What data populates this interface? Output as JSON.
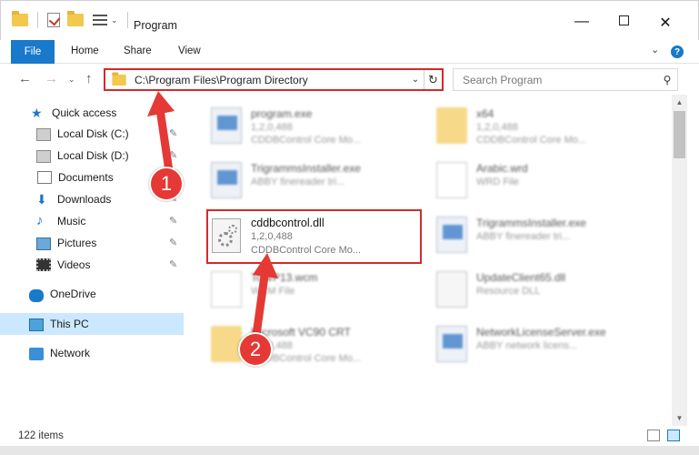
{
  "window": {
    "title": "Program",
    "min_glyph": "—",
    "close_glyph": "✕"
  },
  "ribbon": {
    "file": "File",
    "home": "Home",
    "share": "Share",
    "view": "View",
    "expand_glyph": "⌄",
    "help_glyph": "?"
  },
  "nav": {
    "back_glyph": "←",
    "forward_glyph": "→",
    "history_glyph": "⌄",
    "up_glyph": "↑",
    "address": "C:\\Program Files\\Program Directory",
    "address_dropdown_glyph": "⌄",
    "refresh_glyph": "↻",
    "search_placeholder": "Search Program",
    "search_glyph": "⚲"
  },
  "sidebar": {
    "items": [
      {
        "label": "Quick access",
        "icon": "star-icon"
      },
      {
        "label": "Local Disk (C:)",
        "icon": "disk-icon",
        "pinned": true
      },
      {
        "label": "Local Disk (D:)",
        "icon": "disk-icon",
        "pinned": true
      },
      {
        "label": "Documents",
        "icon": "documents-icon",
        "pinned": true
      },
      {
        "label": "Downloads",
        "icon": "downloads-icon",
        "pinned": true
      },
      {
        "label": "Music",
        "icon": "music-icon",
        "pinned": true
      },
      {
        "label": "Pictures",
        "icon": "pictures-icon",
        "pinned": true
      },
      {
        "label": "Videos",
        "icon": "videos-icon",
        "pinned": true
      },
      {
        "label": "OneDrive",
        "icon": "onedrive-icon"
      },
      {
        "label": "This PC",
        "icon": "this-pc-icon",
        "selected": true
      },
      {
        "label": "Network",
        "icon": "network-icon"
      }
    ],
    "pin_glyph": "📌"
  },
  "files": [
    {
      "name": "program.exe",
      "meta1": "1,2,0,488",
      "meta2": "CDDBControl Core Mo...",
      "type": "exe"
    },
    {
      "name": "x64",
      "meta1": "1,2,0,488",
      "meta2": "CDDBControl Core Mo...",
      "type": "folder"
    },
    {
      "name": "TrigrammsInstaller.exe",
      "meta1": "ABBY finereader tri...",
      "meta2": "",
      "type": "exe"
    },
    {
      "name": "Arabic.wrd",
      "meta1": "WRD File",
      "meta2": "",
      "type": "doc"
    },
    {
      "name": "cddbcontrol.dll",
      "meta1": "1,2,0,488",
      "meta2": "CDDBControl Core Mo...",
      "type": "dll",
      "highlighted": true
    },
    {
      "name": "TrigrammsInstaller.exe",
      "meta1": "ABBY finereader tri...",
      "meta2": "",
      "type": "exe"
    },
    {
      "name": "ToWP13.wcm",
      "meta1": "WCM File",
      "meta2": "",
      "type": "doc"
    },
    {
      "name": "UpdateClient65.dll",
      "meta1": "Resource DLL",
      "meta2": "",
      "type": "dll"
    },
    {
      "name": "Microsoft VC90 CRT",
      "meta1": "1,2,0,488",
      "meta2": "CDDBControl Core Mo...",
      "type": "folder"
    },
    {
      "name": "NetworkLicenseServer.exe",
      "meta1": "ABBY network licens...",
      "meta2": "",
      "type": "exe"
    }
  ],
  "scroll": {
    "up_glyph": "▲",
    "down_glyph": "▼"
  },
  "status": {
    "item_count": "122 items"
  },
  "annotations": {
    "step1": "1",
    "step2": "2",
    "color": "#e53935"
  },
  "colors": {
    "accent": "#1979ca",
    "highlight_border": "#d42a2a",
    "selection": "#cce8ff"
  }
}
